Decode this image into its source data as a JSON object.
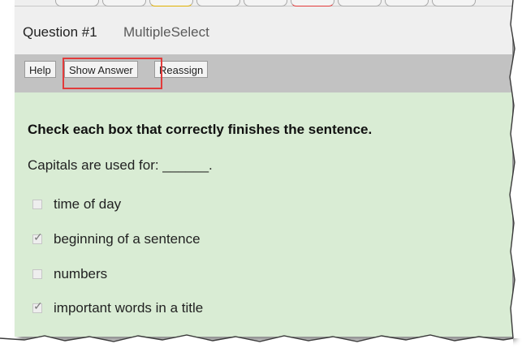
{
  "question": {
    "number_label": "Question #1",
    "type_label": "MultipleSelect"
  },
  "toolbar": {
    "help_label": "Help",
    "show_answer_label": "Show Answer",
    "reassign_label": "Reassign"
  },
  "content": {
    "instruction": "Check each box that correctly finishes the sentence.",
    "prompt": "Capitals are used for: ______.",
    "options": [
      {
        "label": "time of day",
        "checked": false
      },
      {
        "label": "beginning of a sentence",
        "checked": true
      },
      {
        "label": "numbers",
        "checked": false
      },
      {
        "label": "important words in a title",
        "checked": true
      }
    ]
  },
  "colors": {
    "answer_background": "#d9ecd4",
    "toolbar_background": "#c2c2c2",
    "highlight_border": "#e23b3b"
  }
}
